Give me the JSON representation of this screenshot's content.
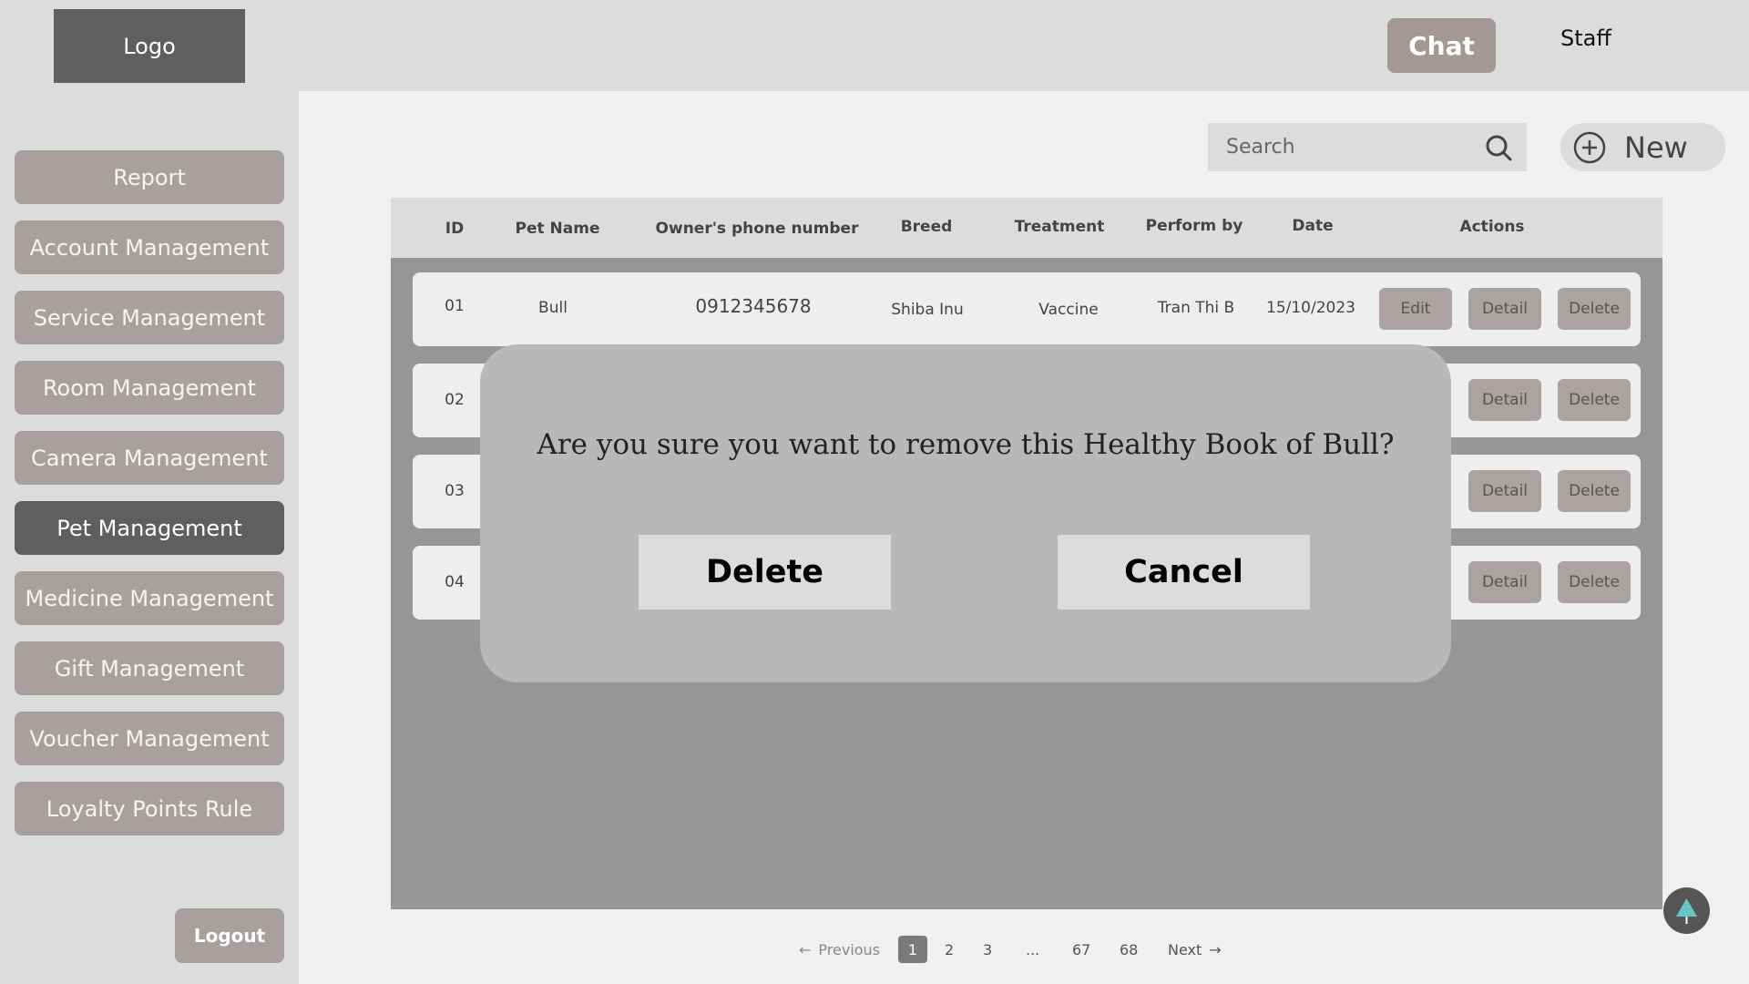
{
  "header": {
    "logo": "Logo",
    "chat_label": "Chat",
    "user_label": "Staff"
  },
  "sidebar": {
    "items": [
      {
        "label": "Report"
      },
      {
        "label": "Account Management"
      },
      {
        "label": "Service Management"
      },
      {
        "label": "Room Management"
      },
      {
        "label": "Camera Management"
      },
      {
        "label": "Pet Management",
        "active": true
      },
      {
        "label": "Medicine Management"
      },
      {
        "label": "Gift Management"
      },
      {
        "label": "Voucher Management"
      },
      {
        "label": "Loyalty Points Rule"
      }
    ],
    "logout_label": "Logout"
  },
  "search": {
    "placeholder": "Search",
    "icon": "search-icon"
  },
  "new_button": {
    "label": "New",
    "icon": "plus-circle-icon"
  },
  "table": {
    "columns": [
      "ID",
      "Pet Name",
      "Owner's phone number",
      "Breed",
      "Treatment",
      "Perform by",
      "Date",
      "Actions"
    ],
    "rows": [
      {
        "id": "01",
        "pet_name": "Bull",
        "phone": "0912345678",
        "breed": "Shiba Inu",
        "treatment": "Vaccine",
        "perform_by": "Tran Thi B",
        "date": "15/10/2023",
        "actions": [
          "Edit",
          "Detail",
          "Delete"
        ]
      },
      {
        "id": "02",
        "actions": [
          "Detail",
          "Delete"
        ]
      },
      {
        "id": "03",
        "actions": [
          "Detail",
          "Delete"
        ]
      },
      {
        "id": "04",
        "actions": [
          "Detail",
          "Delete"
        ]
      }
    ]
  },
  "modal": {
    "message": "Are you sure you want to remove this Healthy Book of Bull?",
    "confirm_label": "Delete",
    "cancel_label": "Cancel"
  },
  "pagination": {
    "previous_label": "Previous",
    "next_label": "Next",
    "pages": [
      "1",
      "2",
      "3",
      "...",
      "67",
      "68"
    ],
    "current": "1"
  },
  "colors": {
    "sidebar_button": "#a8a09f",
    "active_button": "#5f5f5f",
    "modal": "#b8b8b8",
    "scroll_top_arrow": "#66c7c4"
  }
}
